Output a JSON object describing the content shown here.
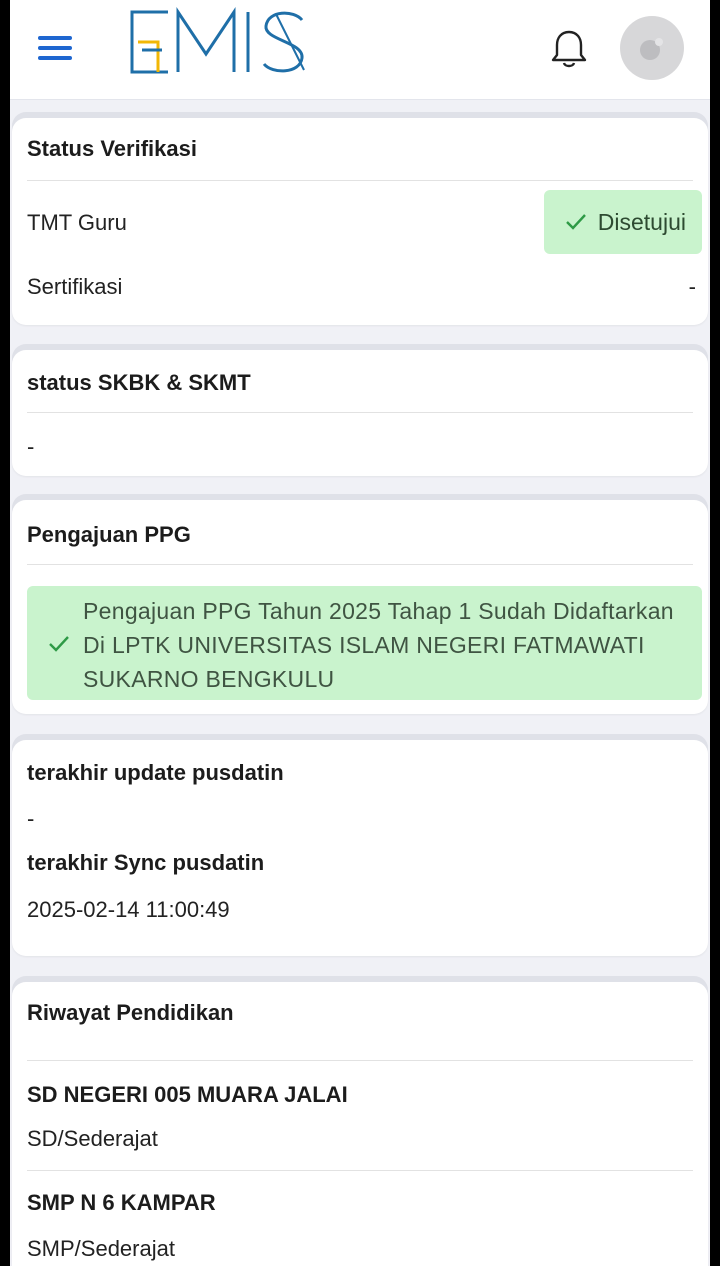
{
  "header": {
    "logo_text": "EMIS",
    "menu_icon": "hamburger-menu-icon",
    "bell_icon": "bell-icon",
    "avatar_icon": "avatar-icon",
    "accent_color": "#1e66d0"
  },
  "status_verifikasi": {
    "title": "Status Verifikasi",
    "rows": [
      {
        "label": "TMT Guru",
        "value": "Disetujui",
        "status_color": "#c9f3cd"
      },
      {
        "label": "Sertifikasi",
        "value": "-"
      }
    ]
  },
  "status_skbk": {
    "title": "status SKBK & SKMT",
    "value": "-"
  },
  "pengajuan_ppg": {
    "title": "Pengajuan PPG",
    "message": "Pengajuan PPG Tahun 2025 Tahap 1 Sudah Didaftarkan Di LPTK UNIVERSITAS ISLAM NEGERI FATMAWATI SUKARNO BENGKULU"
  },
  "pusdatin": {
    "update_label": "terakhir update pusdatin",
    "update_value": "-",
    "sync_label": "terakhir Sync pusdatin",
    "sync_value": "2025-02-14 11:00:49"
  },
  "riwayat": {
    "title": "Riwayat Pendidikan",
    "items": [
      {
        "school": "SD NEGERI 005 MUARA JALAI",
        "level": "SD/Sederajat"
      },
      {
        "school": "SMP N 6 KAMPAR",
        "level": "SMP/Sederajat"
      }
    ]
  }
}
